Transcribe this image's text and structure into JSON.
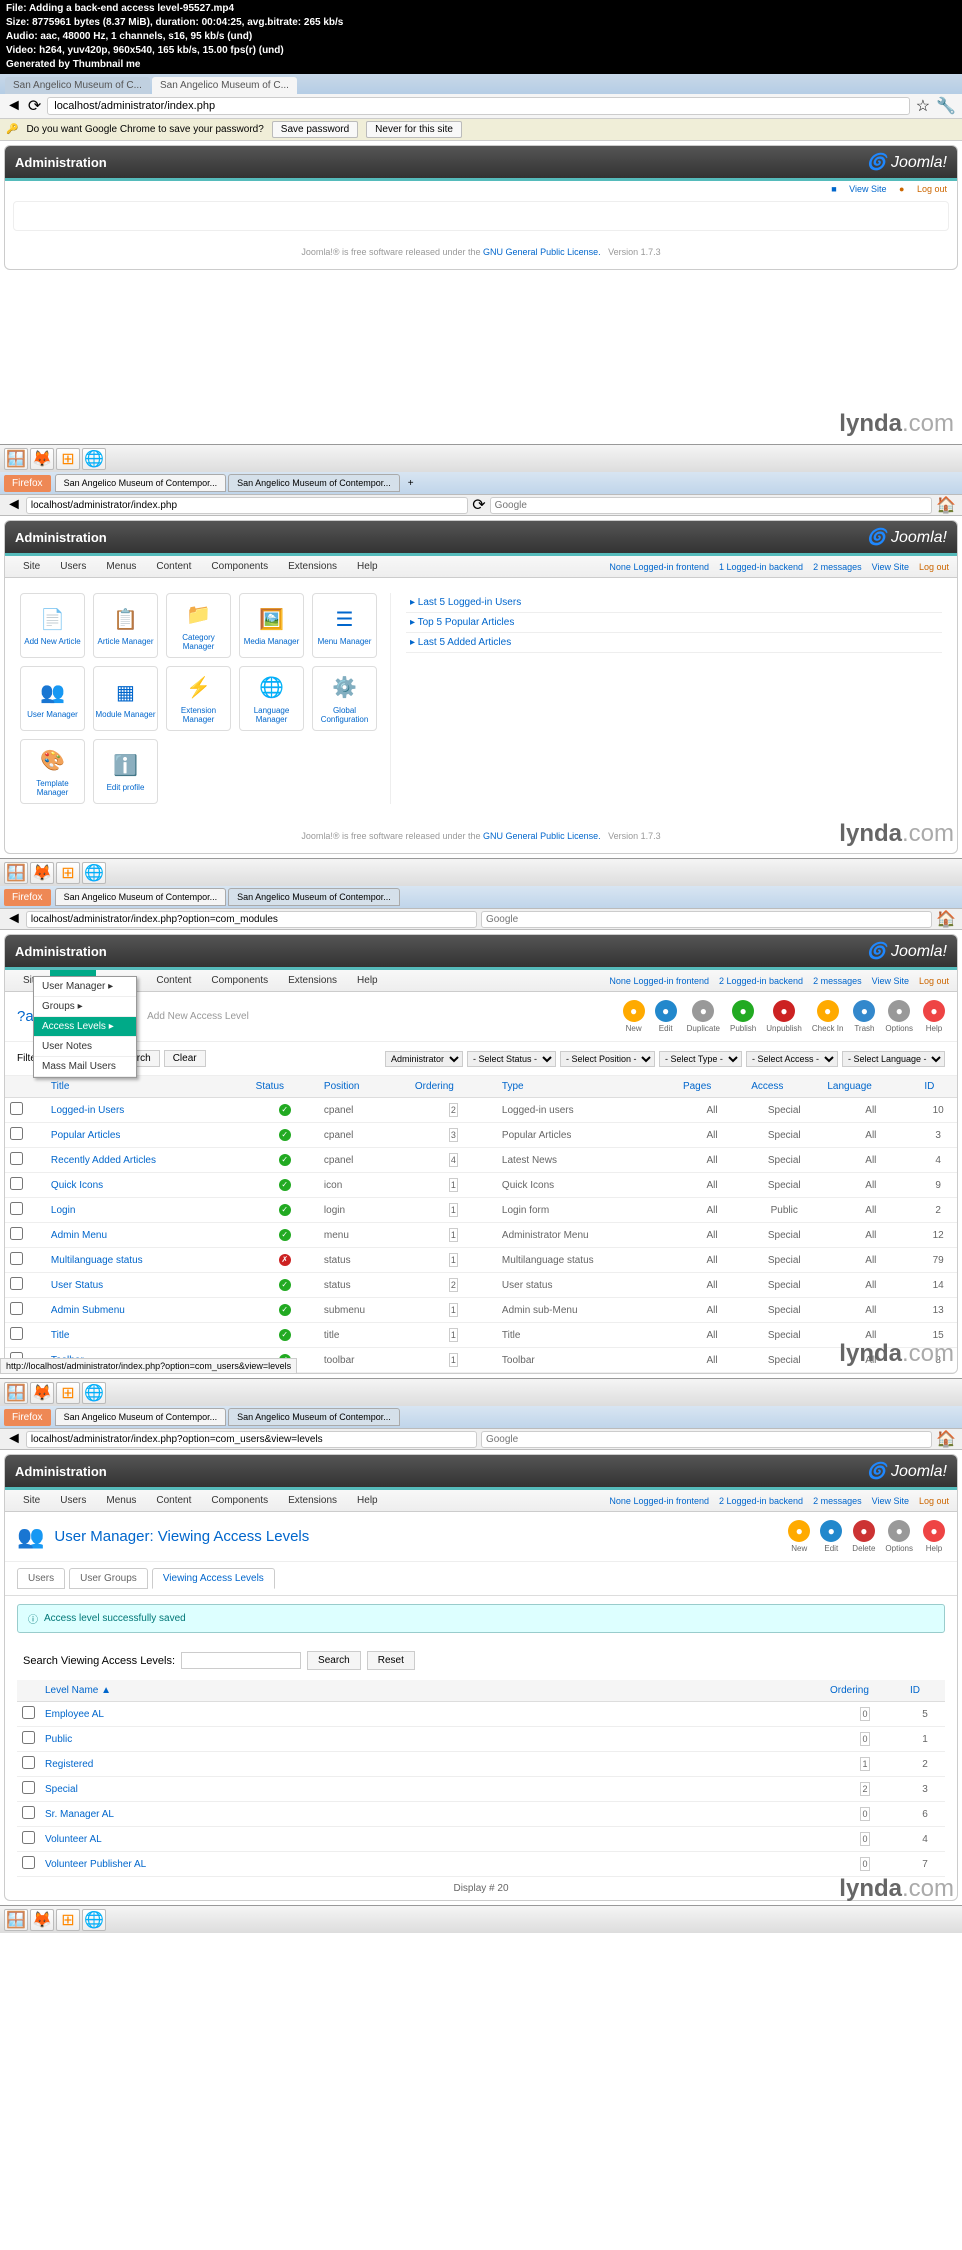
{
  "header": {
    "line1": "File: Adding a back-end access level-95527.mp4",
    "line2": "Size: 8775961 bytes (8.37 MiB), duration: 00:04:25, avg.bitrate: 265 kb/s",
    "line3": "Audio: aac, 48000 Hz, 1 channels, s16, 95 kb/s (und)",
    "line4": "Video: h264, yuv420p, 960x540, 165 kb/s, 15.00 fps(r) (und)",
    "line5": "Generated by Thumbnail me"
  },
  "wm": {
    "a": "lynda",
    "b": ".com"
  },
  "s1": {
    "tab1": "San Angelico Museum of C...",
    "tab2": "San Angelico Museum of C...",
    "url": "localhost/administrator/index.php",
    "pwdQ": "Do you want Google Chrome to save your password?",
    "save": "Save password",
    "never": "Never for this site",
    "admin": "Administration",
    "joo": "Joomla!",
    "view": "View Site",
    "logout": "Log out",
    "foot1": "Joomla!® is free software released under the ",
    "foot2": "GNU General Public License.",
    "foot3": "Version 1.7.3"
  },
  "s2": {
    "fflbl": "Firefox",
    "tab1": "San Angelico Museum of Contempor...",
    "tab2": "San Angelico Museum of Contempor...",
    "url": "localhost/administrator/index.php",
    "srch": "Google",
    "admin": "Administration",
    "m": {
      "site": "Site",
      "users": "Users",
      "menus": "Menus",
      "content": "Content",
      "comp": "Components",
      "ext": "Extensions",
      "help": "Help"
    },
    "st": {
      "none": "None Logged-in frontend",
      "b": "1 Logged-in backend",
      "msg": "2 messages",
      "view": "View Site",
      "out": "Log out"
    },
    "qi": [
      "Add New Article",
      "Article Manager",
      "Category Manager",
      "Media Manager",
      "Menu Manager",
      "User Manager",
      "Module Manager",
      "Extension Manager",
      "Language Manager",
      "Global Configuration",
      "Template Manager",
      "Edit profile"
    ],
    "side": [
      "Last 5 Logged-in Users",
      "Top 5 Popular Articles",
      "Last 5 Added Articles"
    ]
  },
  "s3": {
    "url": "localhost/administrator/index.php?option=com_modules",
    "dd": [
      "User Manager",
      "Groups",
      "Access Levels",
      "User Notes",
      "Mass Mail Users"
    ],
    "ttl": "?anager: Modules",
    "sub": "Add New Access Level",
    "tools": [
      {
        "l": "New",
        "c": "#fa0"
      },
      {
        "l": "Edit",
        "c": "#28c"
      },
      {
        "l": "Duplicate",
        "c": "#999"
      },
      {
        "l": "Publish",
        "c": "#2a2"
      },
      {
        "l": "Unpublish",
        "c": "#c22"
      },
      {
        "l": "Check In",
        "c": "#fa0"
      },
      {
        "l": "Trash",
        "c": "#38c"
      },
      {
        "l": "Options",
        "c": "#999"
      },
      {
        "l": "Help",
        "c": "#e44"
      }
    ],
    "flbl": "Filter:",
    "fbtn": [
      "Search",
      "Clear"
    ],
    "fsel": [
      "Administrator",
      "- Select Status -",
      "- Select Position -",
      "- Select Type -",
      "- Select Access -",
      "- Select Language -"
    ],
    "th": [
      "",
      "Title",
      "Status",
      "Position",
      "Ordering",
      "Type",
      "Pages",
      "Access",
      "Language",
      "ID"
    ],
    "rows": [
      {
        "t": "Logged-in Users",
        "s": 1,
        "p": "cpanel",
        "o": "2",
        "ty": "Logged-in users",
        "pg": "All",
        "ac": "Special",
        "lg": "All",
        "id": "10"
      },
      {
        "t": "Popular Articles",
        "s": 1,
        "p": "cpanel",
        "o": "3",
        "ty": "Popular Articles",
        "pg": "All",
        "ac": "Special",
        "lg": "All",
        "id": "3"
      },
      {
        "t": "Recently Added Articles",
        "s": 1,
        "p": "cpanel",
        "o": "4",
        "ty": "Latest News",
        "pg": "All",
        "ac": "Special",
        "lg": "All",
        "id": "4"
      },
      {
        "t": "Quick Icons",
        "s": 1,
        "p": "icon",
        "o": "1",
        "ty": "Quick Icons",
        "pg": "All",
        "ac": "Special",
        "lg": "All",
        "id": "9"
      },
      {
        "t": "Login",
        "s": 1,
        "p": "login",
        "o": "1",
        "ty": "Login form",
        "pg": "All",
        "ac": "Public",
        "lg": "All",
        "id": "2"
      },
      {
        "t": "Admin Menu",
        "s": 1,
        "p": "menu",
        "o": "1",
        "ty": "Administrator Menu",
        "pg": "All",
        "ac": "Special",
        "lg": "All",
        "id": "12"
      },
      {
        "t": "Multilanguage status",
        "s": 0,
        "p": "status",
        "o": "1",
        "ty": "Multilanguage status",
        "pg": "All",
        "ac": "Special",
        "lg": "All",
        "id": "79"
      },
      {
        "t": "User Status",
        "s": 1,
        "p": "status",
        "o": "2",
        "ty": "User status",
        "pg": "All",
        "ac": "Special",
        "lg": "All",
        "id": "14"
      },
      {
        "t": "Admin Submenu",
        "s": 1,
        "p": "submenu",
        "o": "1",
        "ty": "Admin sub-Menu",
        "pg": "All",
        "ac": "Special",
        "lg": "All",
        "id": "13"
      },
      {
        "t": "Title",
        "s": 1,
        "p": "title",
        "o": "1",
        "ty": "Title",
        "pg": "All",
        "ac": "Special",
        "lg": "All",
        "id": "15"
      },
      {
        "t": "Toolbar",
        "s": 1,
        "p": "toolbar",
        "o": "1",
        "ty": "Toolbar",
        "pg": "All",
        "ac": "Special",
        "lg": "All",
        "id": "8"
      }
    ],
    "statusurl": "http://localhost/administrator/index.php?option=com_users&view=levels"
  },
  "s4": {
    "url": "localhost/administrator/index.php?option=com_users&view=levels",
    "ttl": "User Manager: Viewing Access Levels",
    "tools": [
      {
        "l": "New",
        "c": "#fa0"
      },
      {
        "l": "Edit",
        "c": "#28c"
      },
      {
        "l": "Delete",
        "c": "#c33"
      },
      {
        "l": "Options",
        "c": "#999"
      },
      {
        "l": "Help",
        "c": "#e44"
      }
    ],
    "tabs": [
      "Users",
      "User Groups",
      "Viewing Access Levels"
    ],
    "msg": "Access level successfully saved",
    "slbl": "Search Viewing Access Levels:",
    "sbtn": [
      "Search",
      "Reset"
    ],
    "th": [
      "",
      "Level Name ▲",
      "Ordering",
      "ID"
    ],
    "rows": [
      {
        "n": "Employee AL",
        "o": "0",
        "id": "5"
      },
      {
        "n": "Public",
        "o": "0",
        "id": "1"
      },
      {
        "n": "Registered",
        "o": "1",
        "id": "2"
      },
      {
        "n": "Special",
        "o": "2",
        "id": "3"
      },
      {
        "n": "Sr. Manager AL",
        "o": "0",
        "id": "6"
      },
      {
        "n": "Volunteer AL",
        "o": "0",
        "id": "4"
      },
      {
        "n": "Volunteer Publisher AL",
        "o": "0",
        "id": "7"
      }
    ],
    "disp": "Display # 20"
  }
}
